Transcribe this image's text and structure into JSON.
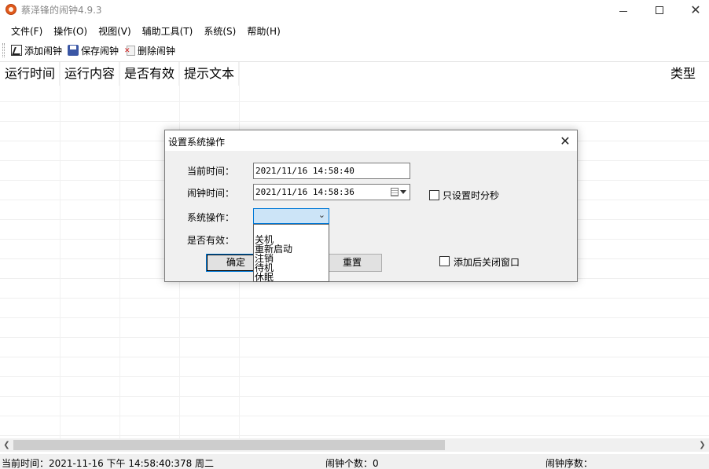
{
  "window": {
    "title": "蔡泽锋的闹钟4.9.3",
    "minimize_glyph": "",
    "close_glyph": "✕"
  },
  "menu": {
    "items": [
      "文件(F)",
      "操作(O)",
      "视图(V)",
      "辅助工具(T)",
      "系统(S)",
      "帮助(H)"
    ]
  },
  "toolbar": {
    "add_label": "添加闹钟",
    "save_label": "保存闹钟",
    "delete_label": "删除闹钟"
  },
  "list": {
    "columns": [
      "运行时间",
      "运行内容",
      "是否有效",
      "提示文本"
    ],
    "type_column": "类型"
  },
  "status": {
    "current_time": "当前时间：2021-11-16 下午 14:58:40:378  周二",
    "alarm_count": "闹钟个数：0",
    "alarm_index": "闹钟序数："
  },
  "dialog": {
    "title": "设置系统操作",
    "close_glyph": "✕",
    "current_time_label": "当前时间：",
    "current_time_value": "2021/11/16 14:58:40",
    "alarm_time_label": "闹钟时间：",
    "alarm_time_value": "2021/11/16 14:58:36",
    "only_hms_label": "只设置时分秒",
    "system_op_label": "系统操作：",
    "system_op_value": "",
    "dropdown_arrow": "⌄",
    "options": [
      "关机",
      "重新启动",
      "注销",
      "待机",
      "休眠"
    ],
    "enabled_label": "是否有效：",
    "ok_label": "确定",
    "reset_label": "重置",
    "close_after_add_label": "添加后关闭窗口"
  },
  "colors": {
    "combo_focus_bg": "#cce4f7",
    "focus_border": "#0078d7"
  }
}
